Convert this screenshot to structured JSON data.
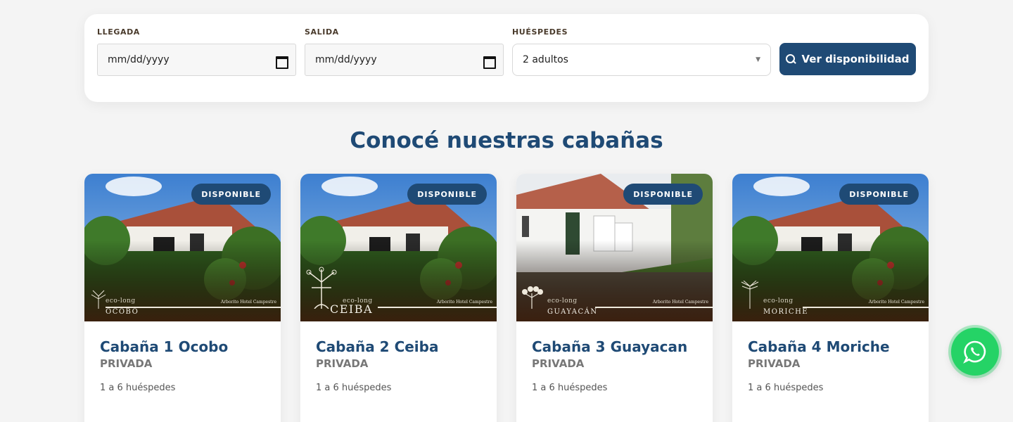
{
  "booking": {
    "arrival_label": "LLEGADA",
    "arrival_value": "mm/dd/yyyy",
    "departure_label": "SALIDA",
    "departure_value": "mm/dd/yyyy",
    "guests_label": "HUÉSPEDES",
    "guests_value": "2 adultos",
    "cta_label": "Ver disponibilidad"
  },
  "section_title": "Conocé nuestras cabañas",
  "colors": {
    "primary": "#1f4a75",
    "whatsapp": "#25d366"
  },
  "cards": [
    {
      "badge": "DISPONIBLE",
      "brand_eco": "eco-long",
      "brand_name": "OCOBO",
      "brand_hotel": "Arborito Hotel Campestre",
      "title": "Cabaña 1 Ocobo",
      "type": "PRIVADA",
      "guests": "1 a 6 huéspedes"
    },
    {
      "badge": "DISPONIBLE",
      "brand_eco": "eco-long",
      "brand_name": "CEIBA",
      "brand_hotel": "Arborito Hotel Campestre",
      "title": "Cabaña 2 Ceiba",
      "type": "PRIVADA",
      "guests": "1 a 6 huéspedes"
    },
    {
      "badge": "DISPONIBLE",
      "brand_eco": "eco-long",
      "brand_name": "GUAYACÁN",
      "brand_hotel": "Arborito Hotel Campestre",
      "title": "Cabaña 3 Guayacan",
      "type": "PRIVADA",
      "guests": "1 a 6 huéspedes"
    },
    {
      "badge": "DISPONIBLE",
      "brand_eco": "eco-long",
      "brand_name": "MORICHE",
      "brand_hotel": "Arborito Hotel Campestre",
      "title": "Cabaña 4 Moriche",
      "type": "PRIVADA",
      "guests": "1 a 6 huéspedes"
    }
  ],
  "icons": {
    "search": "search-icon",
    "calendar": "calendar-icon",
    "whatsapp": "whatsapp-icon"
  }
}
